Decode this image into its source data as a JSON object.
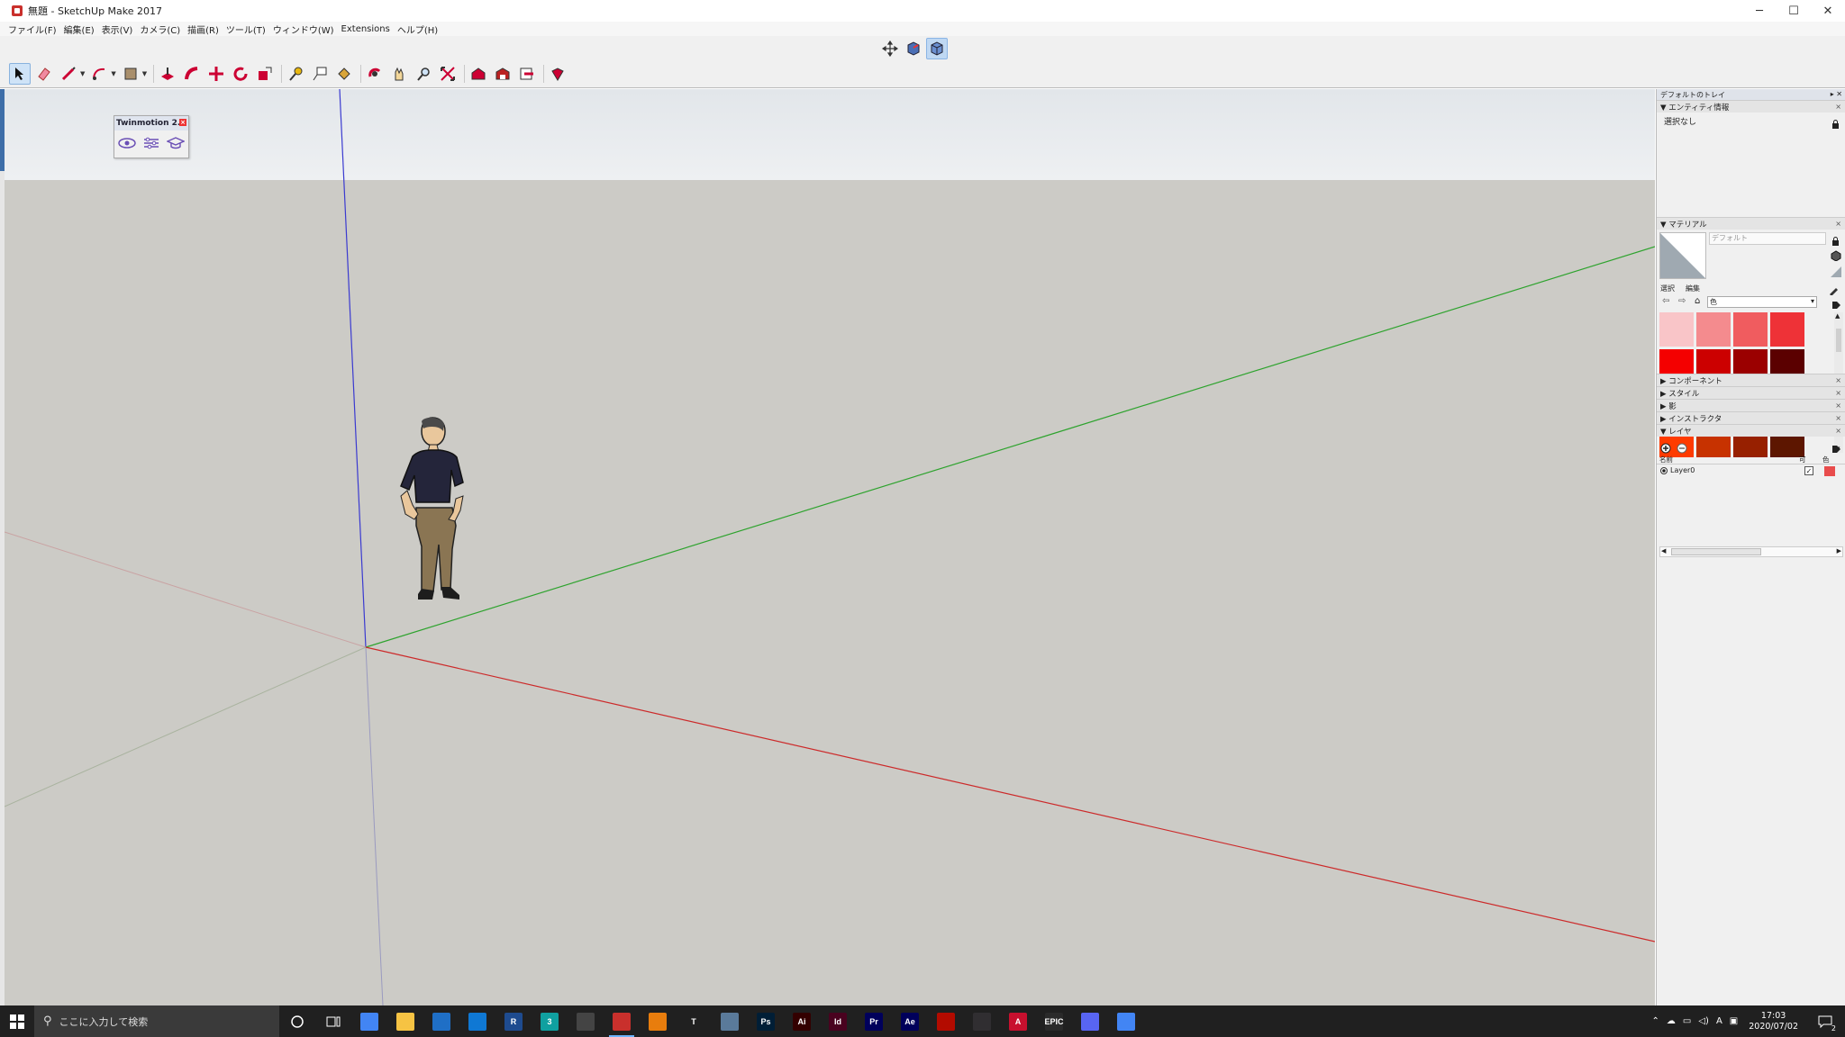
{
  "window": {
    "title": "無題 - SketchUp Make 2017",
    "min_label": "─",
    "max_label": "☐",
    "close_label": "✕"
  },
  "menu": [
    "ファイル(F)",
    "編集(E)",
    "表示(V)",
    "カメラ(C)",
    "描画(R)",
    "ツール(T)",
    "ウィンドウ(W)",
    "Extensions",
    "ヘルプ(H)"
  ],
  "toolbar": {
    "tools": [
      "select-tool",
      "eraser-tool",
      "line-tool",
      "arc-tool",
      "rectangle-tool",
      "push-pull-tool",
      "follow-me-tool",
      "move-tool",
      "rotate-tool",
      "scale-tool",
      "tape-measure-tool",
      "text-tool",
      "paint-bucket-tool",
      "orbit-tool",
      "pan-tool",
      "zoom-tool",
      "zoom-extents-tool",
      "warehouse-tool",
      "extension-warehouse-tool",
      "send-to-layout-tool",
      "extension-manager-tool"
    ],
    "view_tools": [
      "move-axes-icon",
      "section-icon",
      "view-icon"
    ]
  },
  "twinmotion": {
    "title": "Twinmotion 2...",
    "icons": [
      "eye-icon",
      "sliders-icon",
      "graduation-cap-icon"
    ]
  },
  "tray": {
    "title": "デフォルトのトレイ",
    "entity": {
      "header": "▼ エンティティ情報",
      "value": "選択なし"
    },
    "materials": {
      "header": "▼ マテリアル",
      "name_placeholder": "デフォルト",
      "tab_select": "選択",
      "tab_edit": "編集",
      "dropdown_value": "色",
      "swatches": [
        "#f9c5c8",
        "#f48b8e",
        "#f05c5f",
        "#ee3237",
        "#f40000",
        "#cc0000",
        "#9b0000",
        "#5b0000",
        "#fcd3c3",
        "#fcab8e",
        "#fb8b5b",
        "#f96c3a",
        "#fe3b00",
        "#c73200",
        "#972000",
        "#5d1600"
      ]
    },
    "collapsed_sections": [
      "▶ コンポーネント",
      "▶ スタイル",
      "▶ 影",
      "▶ インストラクタ"
    ],
    "layers": {
      "header": "▼ レイヤ",
      "col_name": "名前",
      "col_visible": "可",
      "col_color": "色",
      "rows": [
        {
          "name": "Layer0",
          "color": "#e84c4c"
        }
      ]
    }
  },
  "taskbar": {
    "search_placeholder": "ここに入力して検索",
    "apps": [
      {
        "name": "chrome",
        "label": "",
        "color": "#4285f4"
      },
      {
        "name": "file-explorer",
        "label": "",
        "color": "#f6c343"
      },
      {
        "name": "mail",
        "label": "",
        "color": "#1f6fc6"
      },
      {
        "name": "onedrive-app",
        "label": "",
        "color": "#0f78d4"
      },
      {
        "name": "revit",
        "label": "R",
        "color": "#1e4b8f"
      },
      {
        "name": "3dsmax",
        "label": "3",
        "color": "#10a0a0"
      },
      {
        "name": "rhino",
        "label": "",
        "color": "#444"
      },
      {
        "name": "sketchup",
        "label": "",
        "color": "#c9302c"
      },
      {
        "name": "blender",
        "label": "",
        "color": "#e87d0d"
      },
      {
        "name": "twinmotion",
        "label": "T",
        "color": "#202020"
      },
      {
        "name": "image-viewer",
        "label": "",
        "color": "#5a7a9a"
      },
      {
        "name": "photoshop",
        "label": "Ps",
        "color": "#001e36"
      },
      {
        "name": "illustrator",
        "label": "Ai",
        "color": "#330000"
      },
      {
        "name": "indesign",
        "label": "Id",
        "color": "#49021f"
      },
      {
        "name": "premiere",
        "label": "Pr",
        "color": "#00005b"
      },
      {
        "name": "after-effects",
        "label": "Ae",
        "color": "#00005b"
      },
      {
        "name": "acrobat",
        "label": "",
        "color": "#b30b00"
      },
      {
        "name": "obs",
        "label": "",
        "color": "#302e31"
      },
      {
        "name": "autocad",
        "label": "A",
        "color": "#c8102e"
      },
      {
        "name": "epic-games",
        "label": "EPIC",
        "color": "#2a2a2a"
      },
      {
        "name": "discord",
        "label": "",
        "color": "#5865f2"
      },
      {
        "name": "chrome-2",
        "label": "",
        "color": "#4285f4"
      }
    ],
    "ime": "A",
    "time": "17:03",
    "date": "2020/07/02",
    "notifications": "2"
  }
}
